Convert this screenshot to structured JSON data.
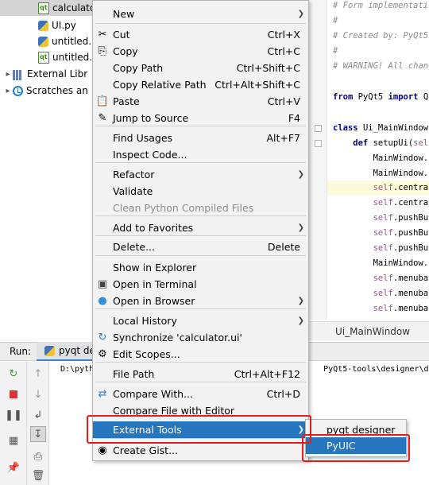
{
  "project_tree": {
    "items": [
      {
        "label": "calculato",
        "icon": "ui-file-icon",
        "selected": true
      },
      {
        "label": "UI.py",
        "icon": "python-file-icon"
      },
      {
        "label": "untitled.p",
        "icon": "python-file-icon"
      },
      {
        "label": "untitled.u",
        "icon": "ui-file-icon"
      },
      {
        "label": "External Libr",
        "icon": "library-icon",
        "expandable": true
      },
      {
        "label": "Scratches an",
        "icon": "scratches-icon",
        "expandable": true
      }
    ]
  },
  "editor": {
    "lines": [
      {
        "parts": [
          {
            "t": "# Form implementatio",
            "c": "comment"
          }
        ]
      },
      {
        "parts": [
          {
            "t": "#",
            "c": "comment"
          }
        ]
      },
      {
        "parts": [
          {
            "t": "# Created by: PyQt5 ",
            "c": "comment"
          }
        ]
      },
      {
        "parts": [
          {
            "t": "#",
            "c": "comment"
          }
        ]
      },
      {
        "parts": [
          {
            "t": "# WARNING! All change",
            "c": "comment"
          }
        ]
      },
      {
        "parts": []
      },
      {
        "parts": [
          {
            "t": "from ",
            "c": "kw"
          },
          {
            "t": "PyQt5 ",
            "c": "plain"
          },
          {
            "t": "import ",
            "c": "kw"
          },
          {
            "t": "Q",
            "c": "plain"
          }
        ]
      },
      {
        "parts": []
      },
      {
        "parts": [
          {
            "t": "class ",
            "c": "kw"
          },
          {
            "t": "Ui_MainWindow",
            "c": "plain"
          }
        ]
      },
      {
        "parts": [
          {
            "t": "    def ",
            "c": "kw"
          },
          {
            "t": "setupUi(",
            "c": "plain"
          },
          {
            "t": "self",
            "c": "self"
          }
        ]
      },
      {
        "parts": [
          {
            "t": "        MainWindow.se",
            "c": "plain"
          }
        ]
      },
      {
        "parts": [
          {
            "t": "        MainWindow.re",
            "c": "plain"
          }
        ]
      },
      {
        "parts": [
          {
            "t": "        ",
            "c": "plain"
          },
          {
            "t": "self",
            "c": "self"
          },
          {
            "t": ".centralw",
            "c": "plain"
          }
        ],
        "highlight": true
      },
      {
        "parts": [
          {
            "t": "        ",
            "c": "plain"
          },
          {
            "t": "self",
            "c": "self"
          },
          {
            "t": ".centralw",
            "c": "plain"
          }
        ]
      },
      {
        "parts": [
          {
            "t": "        ",
            "c": "plain"
          },
          {
            "t": "self",
            "c": "self"
          },
          {
            "t": ".pushButt",
            "c": "plain"
          }
        ]
      },
      {
        "parts": [
          {
            "t": "        ",
            "c": "plain"
          },
          {
            "t": "self",
            "c": "self"
          },
          {
            "t": ".pushButt",
            "c": "plain"
          }
        ]
      },
      {
        "parts": [
          {
            "t": "        ",
            "c": "plain"
          },
          {
            "t": "self",
            "c": "self"
          },
          {
            "t": ".pushButt",
            "c": "plain"
          }
        ]
      },
      {
        "parts": [
          {
            "t": "        MainWindow.se",
            "c": "plain"
          }
        ]
      },
      {
        "parts": [
          {
            "t": "        ",
            "c": "plain"
          },
          {
            "t": "self",
            "c": "self"
          },
          {
            "t": ".menubar",
            "c": "plain"
          }
        ]
      },
      {
        "parts": [
          {
            "t": "        ",
            "c": "plain"
          },
          {
            "t": "self",
            "c": "self"
          },
          {
            "t": ".menubar.",
            "c": "plain"
          }
        ]
      },
      {
        "parts": [
          {
            "t": "        ",
            "c": "plain"
          },
          {
            "t": "self",
            "c": "self"
          },
          {
            "t": ".menubar.",
            "c": "plain"
          }
        ]
      }
    ],
    "breadcrumb": "Ui_MainWindow"
  },
  "run_panel": {
    "label": "Run:",
    "tab_label": "pyqt designer",
    "command": "D:\\pyth                                                PyQt5-tools\\designer\\desig"
  },
  "context_menu": {
    "items": [
      {
        "label": "New",
        "submenu": true
      },
      {
        "label": "Cut",
        "shortcut": "Ctrl+X",
        "icon": "cut-icon"
      },
      {
        "label": "Copy",
        "shortcut": "Ctrl+C",
        "icon": "copy-icon"
      },
      {
        "label": "Copy Path",
        "shortcut": "Ctrl+Shift+C"
      },
      {
        "label": "Copy Relative Path",
        "shortcut": "Ctrl+Alt+Shift+C"
      },
      {
        "label": "Paste",
        "shortcut": "Ctrl+V",
        "icon": "paste-icon"
      },
      {
        "label": "Jump to Source",
        "shortcut": "F4",
        "icon": "jump-to-source-icon"
      },
      {
        "label": "Find Usages",
        "shortcut": "Alt+F7"
      },
      {
        "label": "Inspect Code..."
      },
      {
        "label": "Refactor",
        "submenu": true
      },
      {
        "label": "Validate"
      },
      {
        "label": "Clean Python Compiled Files",
        "disabled": true
      },
      {
        "label": "Add to Favorites",
        "submenu": true
      },
      {
        "label": "Delete...",
        "shortcut": "Delete"
      },
      {
        "label": "Show in Explorer"
      },
      {
        "label": "Open in Terminal",
        "icon": "terminal-icon"
      },
      {
        "label": "Open in Browser",
        "submenu": true,
        "icon": "browser-icon"
      },
      {
        "label": "Local History",
        "submenu": true
      },
      {
        "label": "Synchronize 'calculator.ui'",
        "icon": "synchronize-icon"
      },
      {
        "label": "Edit Scopes...",
        "icon": "edit-scopes-icon"
      },
      {
        "label": "File Path",
        "shortcut": "Ctrl+Alt+F12"
      },
      {
        "label": "Compare With...",
        "shortcut": "Ctrl+D",
        "icon": "compare-icon"
      },
      {
        "label": "Compare File with Editor"
      },
      {
        "label": "External Tools",
        "submenu": true,
        "active": true
      },
      {
        "label": "Create Gist...",
        "icon": "github-icon"
      }
    ]
  },
  "submenu": {
    "items": [
      {
        "label": "pyqt designer"
      },
      {
        "label": "PyUIC",
        "active": true
      }
    ]
  },
  "colors": {
    "menu_highlight": "#2675bf",
    "annotation_red": "#e02020"
  }
}
